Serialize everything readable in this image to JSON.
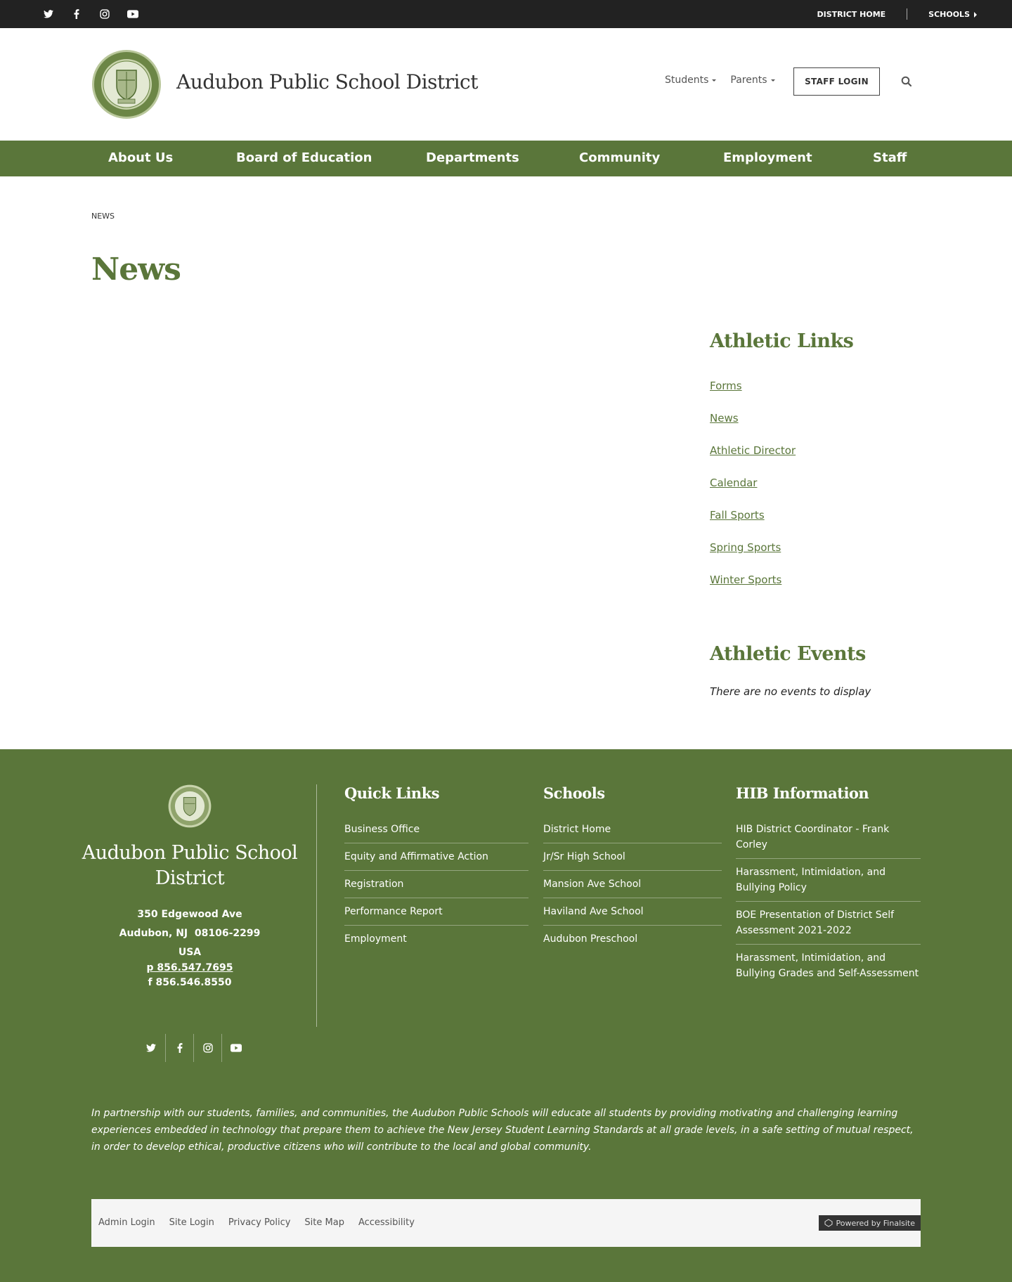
{
  "topbar": {
    "social": [
      "twitter-icon",
      "facebook-icon",
      "instagram-icon",
      "youtube-icon"
    ],
    "district_home": "DISTRICT HOME",
    "schools": "SCHOOLS"
  },
  "header": {
    "site_title": "Audubon Public School District",
    "nav": [
      {
        "label": "Students"
      },
      {
        "label": "Parents"
      }
    ],
    "staff_login": "STAFF LOGIN"
  },
  "mainnav": {
    "items": [
      {
        "label": "About Us"
      },
      {
        "label": "Board of Education"
      },
      {
        "label": "Departments"
      },
      {
        "label": "Community"
      },
      {
        "label": "Employment"
      },
      {
        "label": "Staff"
      }
    ]
  },
  "breadcrumb": "NEWS",
  "page_title": "News",
  "sidebar": {
    "links_heading": "Athletic Links",
    "links": [
      {
        "label": "Forms"
      },
      {
        "label": "News"
      },
      {
        "label": "Athletic Director"
      },
      {
        "label": "Calendar"
      },
      {
        "label": "Fall Sports"
      },
      {
        "label": "Spring Sports"
      },
      {
        "label": "Winter Sports"
      }
    ],
    "events_heading": "Athletic Events",
    "no_events": "There are no events to display"
  },
  "footer": {
    "title": "Audubon Public School District",
    "address_line1": "350 Edgewood Ave",
    "address_line2": "Audubon, NJ  08106-2299",
    "country": "USA",
    "phone": "p 856.547.7695",
    "fax": "f 856.546.8550",
    "quick_links": {
      "heading": "Quick Links",
      "items": [
        "Business Office",
        "Equity and Affirmative Action",
        "Registration",
        "Performance Report",
        "Employment"
      ]
    },
    "schools": {
      "heading": "Schools",
      "items": [
        "District Home",
        "Jr/Sr High School",
        "Mansion Ave School",
        "Haviland Ave School",
        "Audubon Preschool"
      ]
    },
    "hib": {
      "heading": "HIB Information",
      "items": [
        "HIB District Coordinator - Frank Corley",
        "Harassment, Intimidation, and Bullying Policy",
        "BOE Presentation of District Self Assessment 2021-2022",
        "Harassment, Intimidation, and Bullying Grades and Self-Assessment"
      ]
    },
    "mission": "In partnership with our students, families, and communities, the Audubon Public Schools will educate all students by providing motivating and challenging learning experiences embedded in technology that prepare them to achieve the New Jersey Student Learning Standards at all grade levels, in a safe setting of mutual respect, in order to develop ethical, productive citizens who will contribute to the local and global community.",
    "bottom_links": [
      "Admin Login",
      "Site Login",
      "Privacy Policy",
      "Site Map",
      "Accessibility"
    ],
    "powered_by": "Powered by Finalsite"
  },
  "colors": {
    "brand_green": "#5a763a",
    "topbar": "#222222"
  }
}
